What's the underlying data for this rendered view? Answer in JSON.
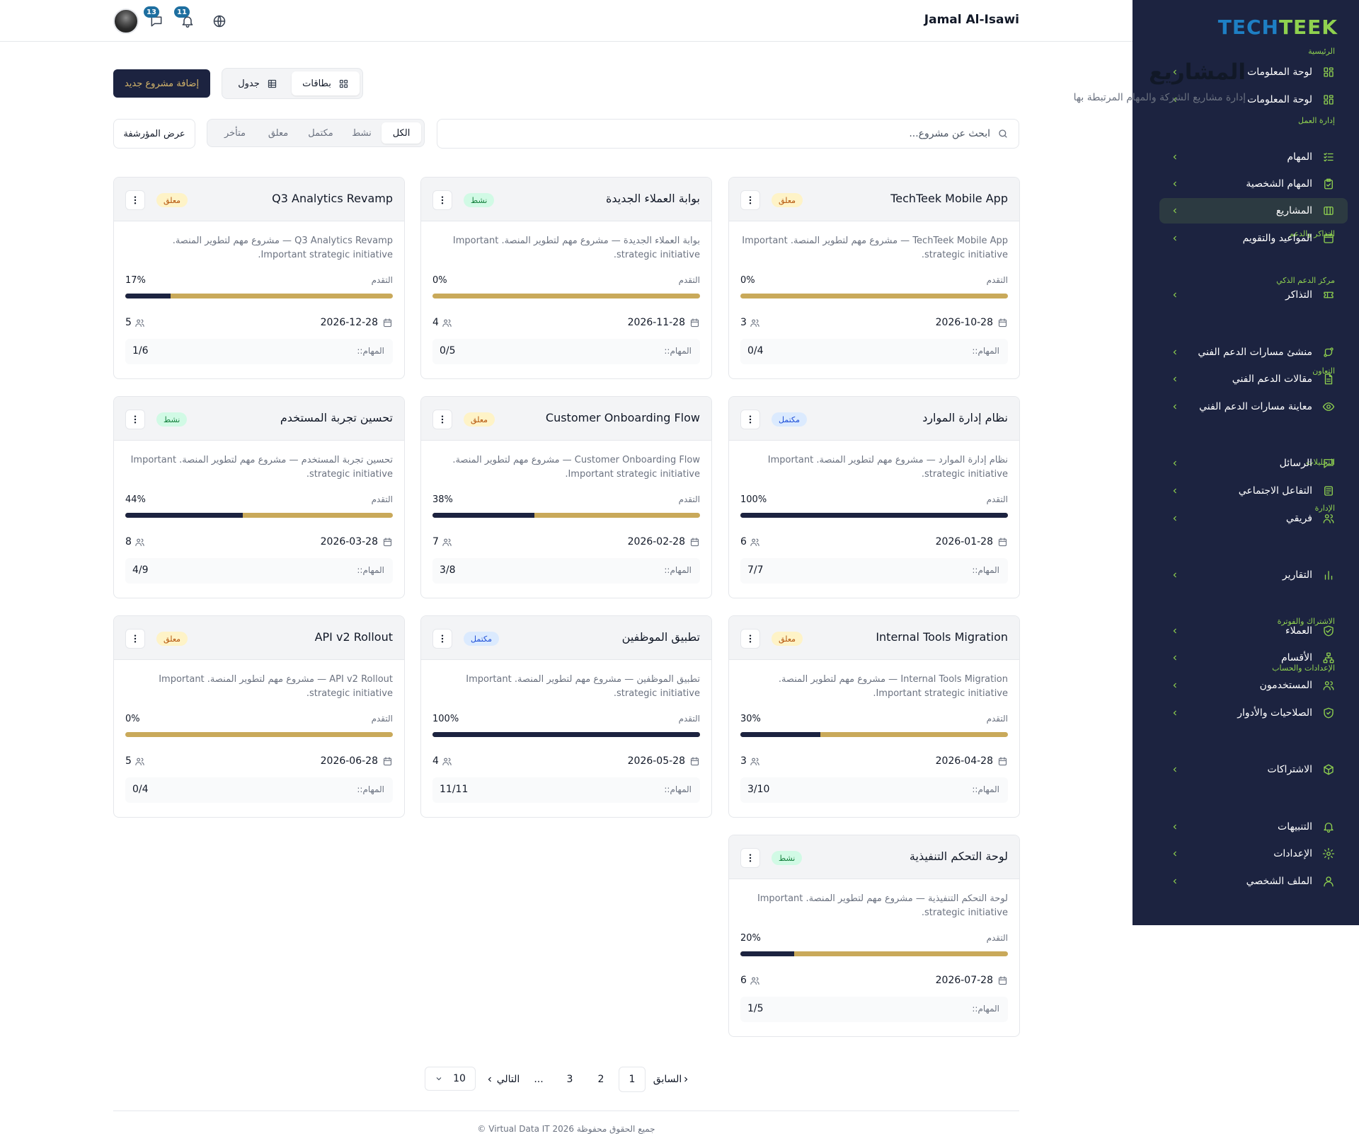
{
  "sidebar": {
    "brand": {
      "part1": "TECH",
      "part2": "TEEK"
    },
    "sections": [
      {
        "id": "home",
        "label": "الرئيسية"
      },
      {
        "id": "work",
        "label": "إدارة العمل"
      },
      {
        "id": "tickets",
        "label": "التذاكر والدعم"
      },
      {
        "id": "smart",
        "label": "مركز الدعم الذكي"
      },
      {
        "id": "collab",
        "label": "التعاون"
      },
      {
        "id": "analytics",
        "label": "التحليلات"
      },
      {
        "id": "admin",
        "label": "الإدارة"
      },
      {
        "id": "billing",
        "label": "الاشتراك والفوترة"
      },
      {
        "id": "settings",
        "label": "الإعدادات والحساب"
      }
    ],
    "items": [
      {
        "label": "لوحة المعلومات",
        "icon": "dashboard-icon"
      },
      {
        "label": "لوحة المعلومات",
        "icon": "dashboard-icon"
      },
      {
        "label": "المهام",
        "icon": "task-list-icon"
      },
      {
        "label": "المهام الشخصية",
        "icon": "clipboard-check-icon"
      },
      {
        "label": "المشاريع",
        "icon": "projects-icon"
      },
      {
        "label": "المواعيد والتقويم",
        "icon": "calendar-icon"
      },
      {
        "label": "التذاكر",
        "icon": "ticket-icon"
      },
      {
        "label": "منشئ مسارات الدعم الفني",
        "icon": "flow-icon"
      },
      {
        "label": "مقالات الدعم الفني",
        "icon": "document-icon"
      },
      {
        "label": "معاينة مسارات الدعم الفني",
        "icon": "eye-icon"
      },
      {
        "label": "الرسائل",
        "icon": "message-icon"
      },
      {
        "label": "التفاعل الاجتماعي",
        "icon": "social-feed-icon"
      },
      {
        "label": "فريقي",
        "icon": "team-icon"
      },
      {
        "label": "التقارير",
        "icon": "bar-chart-icon"
      },
      {
        "label": "العملاء",
        "icon": "handshake-icon"
      },
      {
        "label": "الأقسام",
        "icon": "org-chart-icon"
      },
      {
        "label": "المستخدمون",
        "icon": "users-icon"
      },
      {
        "label": "الصلاحيات والأدوار",
        "icon": "shield-check-icon"
      },
      {
        "label": "الاشتراكات",
        "icon": "package-icon"
      },
      {
        "label": "التنبيهات",
        "icon": "bell-icon"
      },
      {
        "label": "الإعدادات",
        "icon": "gear-icon"
      },
      {
        "label": "الملف الشخصي",
        "icon": "user-icon"
      }
    ],
    "active_index": 4
  },
  "header": {
    "user_name": "Jamal Al-Isawi",
    "messages_count": "13",
    "notifications_count": "11"
  },
  "page": {
    "title": "المشاريع",
    "subtitle": "إدارة مشاريع الشركة والمهام المرتبطة بها",
    "add_button": "إضافة مشروع جديد",
    "view_cards": "بطاقات",
    "view_table": "جدول",
    "search_placeholder": "ابحث عن مشروع...",
    "filters": [
      "الكل",
      "نشط",
      "مكتمل",
      "معلق",
      "متأخر"
    ],
    "active_filter": 0,
    "archived_button": "عرض المؤرشفة"
  },
  "labels": {
    "progress": "التقدم",
    "tasks": "المهام::"
  },
  "colors": {
    "sidebar_bg": "#1c2340",
    "accent_green": "#8fd14f",
    "brand_blue": "#1e7fc4",
    "progress_gold": "#c9a95a",
    "progress_navy": "#1c2340"
  },
  "projects": [
    {
      "title": "TechTeek Mobile App",
      "status": "معلق",
      "status_kind": "on-hold",
      "description": "TechTeek Mobile App — مشروع مهم لتطوير المنصة. Important strategic initiative.",
      "progress_text": "0%",
      "progress": 0,
      "due_date": "2026-10-28",
      "members": "3",
      "tasks": "0/4"
    },
    {
      "title": "بوابة العملاء الجديدة",
      "status": "نشط",
      "status_kind": "active",
      "description": "بوابة العملاء الجديدة — مشروع مهم لتطوير المنصة. Important strategic initiative.",
      "progress_text": "0%",
      "progress": 0,
      "due_date": "2026-11-28",
      "members": "4",
      "tasks": "0/5"
    },
    {
      "title": "Q3 Analytics Revamp",
      "status": "معلق",
      "status_kind": "on-hold",
      "description": "Q3 Analytics Revamp — مشروع مهم لتطوير المنصة. Important strategic initiative.",
      "progress_text": "17%",
      "progress": 17,
      "due_date": "2026-12-28",
      "members": "5",
      "tasks": "1/6"
    },
    {
      "title": "نظام إدارة الموارد",
      "status": "مكتمل",
      "status_kind": "completed",
      "description": "نظام إدارة الموارد — مشروع مهم لتطوير المنصة. Important strategic initiative.",
      "progress_text": "100%",
      "progress": 100,
      "due_date": "2026-01-28",
      "members": "6",
      "tasks": "7/7"
    },
    {
      "title": "Customer Onboarding Flow",
      "status": "معلق",
      "status_kind": "on-hold",
      "description": "Customer Onboarding Flow — مشروع مهم لتطوير المنصة. Important strategic initiative.",
      "progress_text": "38%",
      "progress": 38,
      "due_date": "2026-02-28",
      "members": "7",
      "tasks": "3/8"
    },
    {
      "title": "تحسين تجربة المستخدم",
      "status": "نشط",
      "status_kind": "active",
      "description": "تحسين تجربة المستخدم — مشروع مهم لتطوير المنصة. Important strategic initiative.",
      "progress_text": "44%",
      "progress": 44,
      "due_date": "2026-03-28",
      "members": "8",
      "tasks": "4/9"
    },
    {
      "title": "Internal Tools Migration",
      "status": "معلق",
      "status_kind": "on-hold",
      "description": "Internal Tools Migration — مشروع مهم لتطوير المنصة. Important strategic initiative.",
      "progress_text": "30%",
      "progress": 30,
      "due_date": "2026-04-28",
      "members": "3",
      "tasks": "3/10"
    },
    {
      "title": "تطبيق الموظفين",
      "status": "مكتمل",
      "status_kind": "completed",
      "description": "تطبيق الموظفين — مشروع مهم لتطوير المنصة. Important strategic initiative.",
      "progress_text": "100%",
      "progress": 100,
      "due_date": "2026-05-28",
      "members": "4",
      "tasks": "11/11"
    },
    {
      "title": "API v2 Rollout",
      "status": "معلق",
      "status_kind": "on-hold",
      "description": "API v2 Rollout — مشروع مهم لتطوير المنصة. Important strategic initiative.",
      "progress_text": "0%",
      "progress": 0,
      "due_date": "2026-06-28",
      "members": "5",
      "tasks": "0/4"
    },
    {
      "title": "لوحة التحكم التنفيذية",
      "status": "نشط",
      "status_kind": "active",
      "description": "لوحة التحكم التنفيذية — مشروع مهم لتطوير المنصة. Important strategic initiative.",
      "progress_text": "20%",
      "progress": 20,
      "due_date": "2026-07-28",
      "members": "6",
      "tasks": "1/5"
    }
  ],
  "pagination": {
    "prev": "السابق",
    "next": "التالي",
    "pages": [
      "1",
      "2",
      "3"
    ],
    "ellipsis": "...",
    "active_page": "1",
    "page_size": "10"
  },
  "footer": {
    "text": "جميع الحقوق محفوظة 2026 Virtual Data IT ©"
  }
}
